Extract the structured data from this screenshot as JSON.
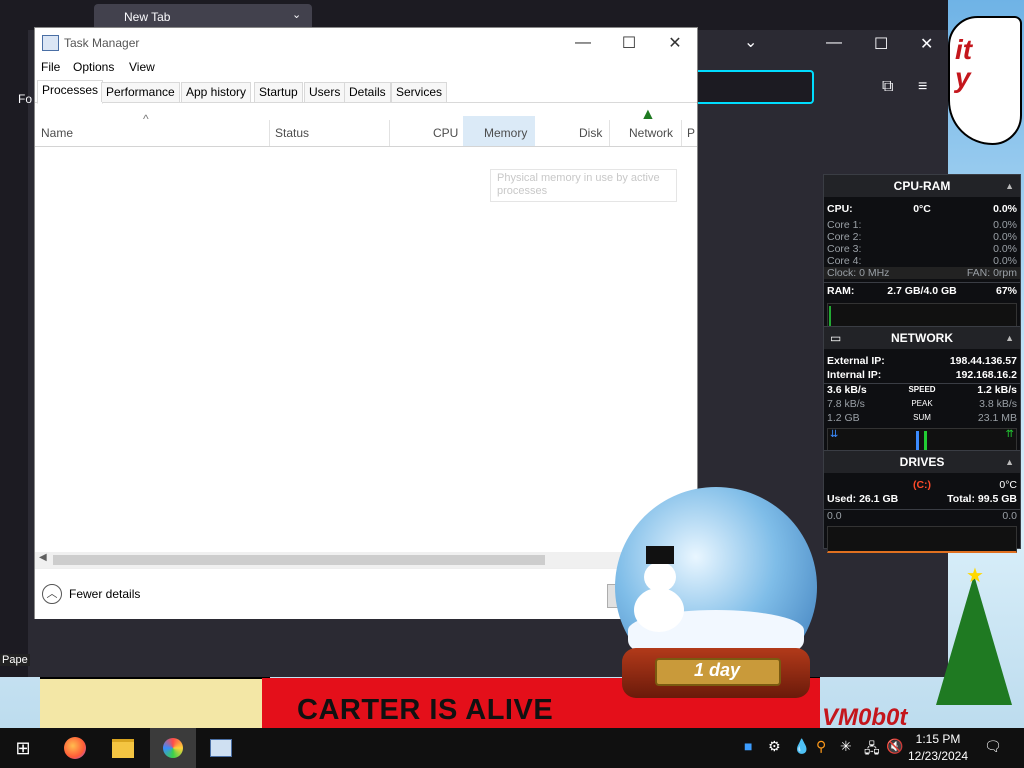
{
  "desktop": {
    "bubble_text": "it\ny",
    "banner_text": "CARTER IS ALIVE",
    "sign_text": "VM0b0t",
    "papers_label": "Pape"
  },
  "browser": {
    "tab_label": "New Tab",
    "left_label": "Fo"
  },
  "task_manager": {
    "title": "Task Manager",
    "menu": [
      "File",
      "Options",
      "View"
    ],
    "tabs": [
      "Processes",
      "Performance",
      "App history",
      "Startup",
      "Users",
      "Details",
      "Services"
    ],
    "active_tab": "Processes",
    "columns": [
      "Name",
      "Status",
      "CPU",
      "Memory",
      "Disk",
      "Network",
      "P"
    ],
    "sort_indicator": "^",
    "tooltip": "Physical memory in use by active processes",
    "fewer_details": "Fewer details"
  },
  "gadgets": {
    "cpu_ram": {
      "title": "CPU-RAM",
      "cpu_label": "CPU:",
      "cpu_temp": "0°C",
      "cpu_pct": "0.0%",
      "cores": [
        {
          "label": "Core 1:",
          "value": "0.0%"
        },
        {
          "label": "Core 2:",
          "value": "0.0%"
        },
        {
          "label": "Core 3:",
          "value": "0.0%"
        },
        {
          "label": "Core 4:",
          "value": "0.0%"
        }
      ],
      "clock": "Clock: 0 MHz",
      "fan": "FAN: 0rpm",
      "ram_label": "RAM:",
      "ram_value": "2.7 GB/4.0 GB",
      "ram_pct": "67%"
    },
    "network": {
      "title": "NETWORK",
      "external_label": "External IP:",
      "external_ip": "198.44.136.57",
      "internal_label": "Internal IP:",
      "internal_ip": "192.168.16.2",
      "speed": {
        "down": "3.6 kB/s",
        "label": "SPEED",
        "up": "1.2 kB/s"
      },
      "peak": {
        "down": "7.8 kB/s",
        "label": "PEAK",
        "up": "3.8 kB/s"
      },
      "sum": {
        "down": "1.2 GB",
        "label": "SUM",
        "up": "23.1 MB"
      }
    },
    "drives": {
      "title": "DRIVES",
      "drive_letter": "(C:)",
      "temp": "0°C",
      "used": "Used: 26.1 GB",
      "total": "Total: 99.5 GB",
      "read": "0.0",
      "write": "0.0"
    }
  },
  "snow_globe": {
    "plate_text": "1 day"
  },
  "taskbar": {
    "time": "1:15 PM",
    "date": "12/23/2024"
  },
  "colors": {
    "banner_red": "#e40f1a",
    "urlbar_accent": "#00ddff",
    "ram_bar": "#22aa33"
  }
}
